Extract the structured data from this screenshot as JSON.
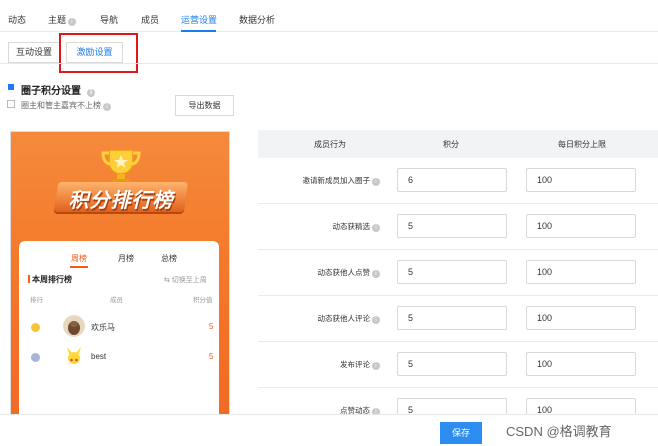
{
  "nav": {
    "items": [
      "动态",
      "主题",
      "导航",
      "成员",
      "运营设置",
      "数据分析"
    ],
    "active_index": 4
  },
  "subtabs": [
    "互动设置",
    "激励设置"
  ],
  "section": {
    "title": "圈子积分设置",
    "checkbox_label": "圈主和管主嘉宾不上榜",
    "export_label": "导出数据"
  },
  "preview": {
    "banner_title": "积分排行榜",
    "tabs": [
      "周榜",
      "月榜",
      "总榜"
    ],
    "week_header": "本周排行榜",
    "switch_label": "⇆ 切换至上周",
    "columns": [
      "排行",
      "成员",
      "积分值"
    ],
    "rows": [
      {
        "name": "欢乐马",
        "score": "5"
      },
      {
        "name": "best",
        "score": "5"
      }
    ]
  },
  "table": {
    "headers": [
      "成员行为",
      "积分",
      "每日积分上限"
    ],
    "rows": [
      {
        "label": "邀请新成员加入圈子",
        "points": "6",
        "limit": "100"
      },
      {
        "label": "动态获精选",
        "points": "5",
        "limit": "100"
      },
      {
        "label": "动态获他人点赞",
        "points": "5",
        "limit": "100"
      },
      {
        "label": "动态获他人评论",
        "points": "5",
        "limit": "100"
      },
      {
        "label": "发布评论",
        "points": "5",
        "limit": "100"
      },
      {
        "label": "点赞动态",
        "points": "5",
        "limit": "100"
      }
    ]
  },
  "footer": {
    "save_label": "保存",
    "watermark": "CSDN @格调教育"
  },
  "colors": {
    "accent": "#1a7cf0",
    "highlight": "#e0161b",
    "orange": "#f25a1f"
  }
}
